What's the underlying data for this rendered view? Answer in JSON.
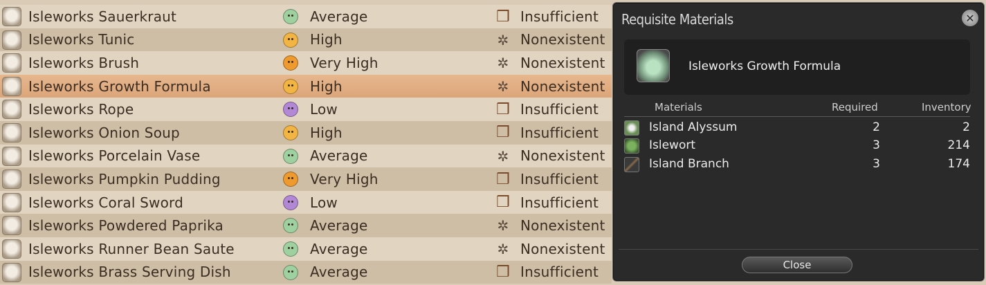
{
  "items": [
    {
      "name": "Isleworks Sauerkraut",
      "popularity": "Average",
      "mood": "avg",
      "supply": "Insufficient",
      "supply_icon": "box"
    },
    {
      "name": "Isleworks Tunic",
      "popularity": "High",
      "mood": "high",
      "supply": "Nonexistent",
      "supply_icon": "spark"
    },
    {
      "name": "Isleworks Brush",
      "popularity": "Very High",
      "mood": "vhigh",
      "supply": "Nonexistent",
      "supply_icon": "spark"
    },
    {
      "name": "Isleworks Growth Formula",
      "popularity": "High",
      "mood": "high",
      "supply": "Nonexistent",
      "supply_icon": "spark",
      "selected": true
    },
    {
      "name": "Isleworks Rope",
      "popularity": "Low",
      "mood": "low",
      "supply": "Insufficient",
      "supply_icon": "box"
    },
    {
      "name": "Isleworks Onion Soup",
      "popularity": "High",
      "mood": "high",
      "supply": "Insufficient",
      "supply_icon": "box"
    },
    {
      "name": "Isleworks Porcelain Vase",
      "popularity": "Average",
      "mood": "avg",
      "supply": "Nonexistent",
      "supply_icon": "spark"
    },
    {
      "name": "Isleworks Pumpkin Pudding",
      "popularity": "Very High",
      "mood": "vhigh",
      "supply": "Insufficient",
      "supply_icon": "box"
    },
    {
      "name": "Isleworks Coral Sword",
      "popularity": "Low",
      "mood": "low",
      "supply": "Insufficient",
      "supply_icon": "box"
    },
    {
      "name": "Isleworks Powdered Paprika",
      "popularity": "Average",
      "mood": "avg",
      "supply": "Nonexistent",
      "supply_icon": "spark"
    },
    {
      "name": "Isleworks Runner Bean Saute",
      "popularity": "Average",
      "mood": "avg",
      "supply": "Nonexistent",
      "supply_icon": "spark"
    },
    {
      "name": "Isleworks Brass Serving Dish",
      "popularity": "Average",
      "mood": "avg",
      "supply": "Insufficient",
      "supply_icon": "box"
    }
  ],
  "panel": {
    "title": "Requisite Materials",
    "close_glyph": "✕",
    "product_name": "Isleworks Growth Formula",
    "headers": {
      "materials": "Materials",
      "required": "Required",
      "inventory": "Inventory"
    },
    "materials": [
      {
        "name": "Island Alyssum",
        "required": "2",
        "inventory": "2"
      },
      {
        "name": "Islewort",
        "required": "3",
        "inventory": "214"
      },
      {
        "name": "Island Branch",
        "required": "3",
        "inventory": "174"
      }
    ],
    "close_label": "Close"
  },
  "icons": {
    "box": "❒",
    "spark": "✲"
  }
}
